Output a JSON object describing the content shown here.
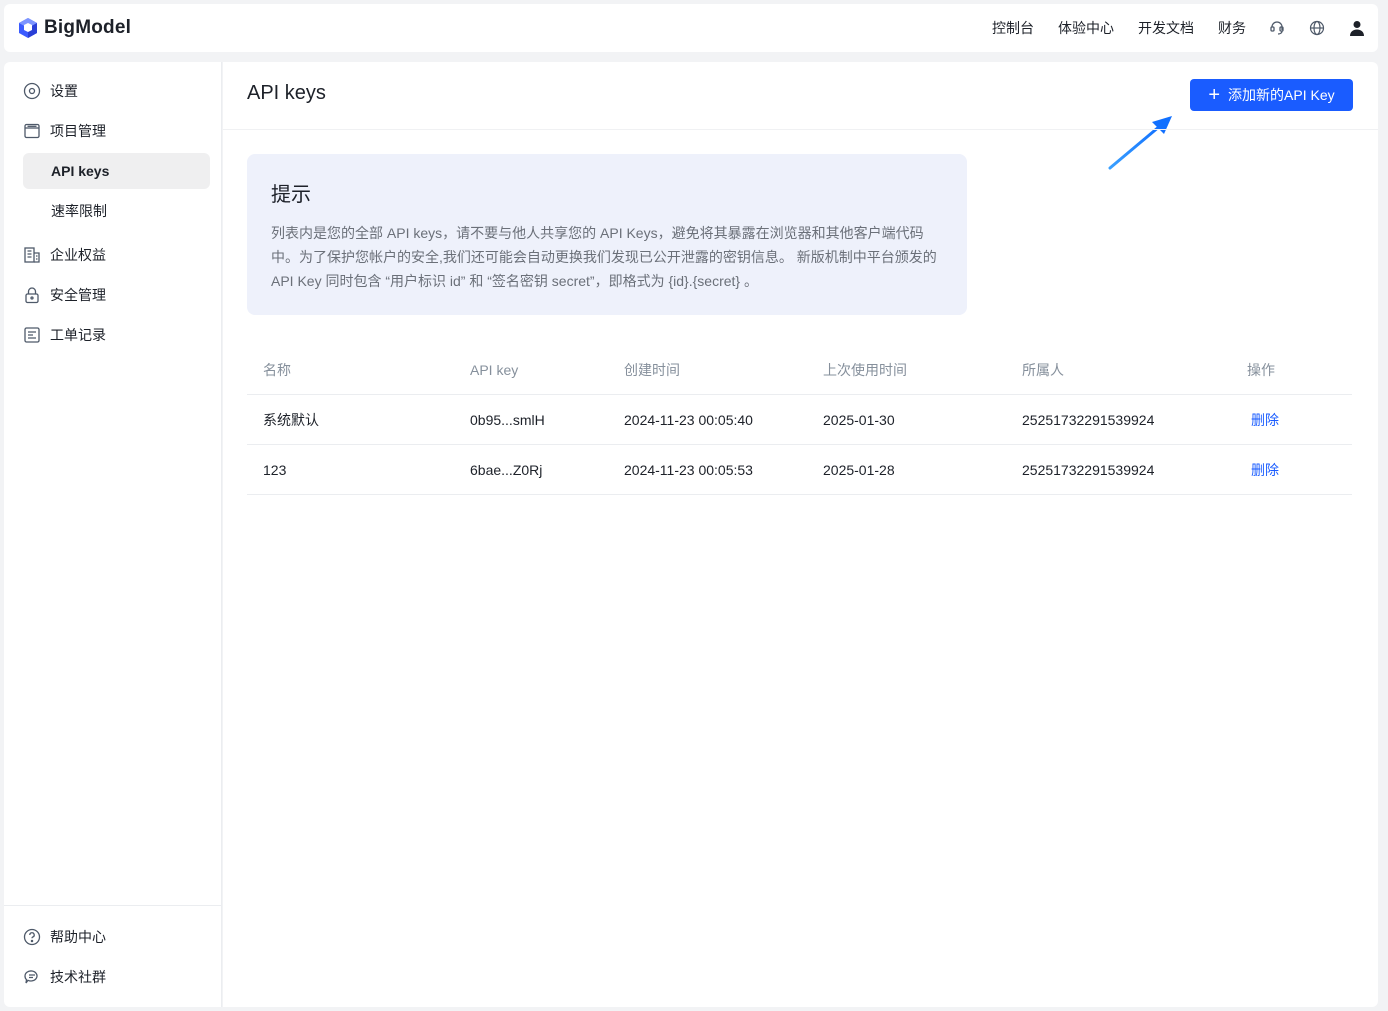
{
  "brand": {
    "name": "BigModel"
  },
  "topnav": {
    "links": [
      "控制台",
      "体验中心",
      "开发文档",
      "财务"
    ],
    "icons": [
      "support-icon",
      "globe-icon",
      "user-icon"
    ]
  },
  "sidebar": {
    "items": [
      {
        "label": "设置",
        "icon": "settings-icon"
      },
      {
        "label": "项目管理",
        "icon": "folder-icon"
      },
      {
        "label": "API keys",
        "active": true
      },
      {
        "label": "速率限制"
      },
      {
        "label": "企业权益",
        "icon": "building-icon"
      },
      {
        "label": "安全管理",
        "icon": "lock-icon"
      },
      {
        "label": "工单记录",
        "icon": "ticket-icon"
      }
    ],
    "footer": [
      {
        "label": "帮助中心",
        "icon": "help-icon"
      },
      {
        "label": "技术社群",
        "icon": "chat-icon"
      }
    ]
  },
  "main": {
    "title": "API keys",
    "add_button_label": "添加新的API Key",
    "tip": {
      "title": "提示",
      "body": "列表内是您的全部 API keys，请不要与他人共享您的 API Keys，避免将其暴露在浏览器和其他客户端代码中。为了保护您帐户的安全,我们还可能会自动更换我们发现已公开泄露的密钥信息。 新版机制中平台颁发的 API Key 同时包含 “用户标识 id” 和 “签名密钥 secret”，即格式为 {id}.{secret} 。"
    },
    "table": {
      "columns": [
        "名称",
        "API key",
        "创建时间",
        "上次使用时间",
        "所属人",
        "操作"
      ],
      "rows": [
        {
          "name": "系统默认",
          "key": "0b95...smlH",
          "created": "2024-11-23 00:05:40",
          "last_used": "2025-01-30",
          "owner": "25251732291539924",
          "action": "删除"
        },
        {
          "name": "123",
          "key": "6bae...Z0Rj",
          "created": "2024-11-23 00:05:53",
          "last_used": "2025-01-28",
          "owner": "25251732291539924",
          "action": "删除"
        }
      ]
    }
  },
  "colors": {
    "accent": "#1a5cff",
    "tip_bg": "#eef1fb",
    "arrow": "#1890ff"
  }
}
